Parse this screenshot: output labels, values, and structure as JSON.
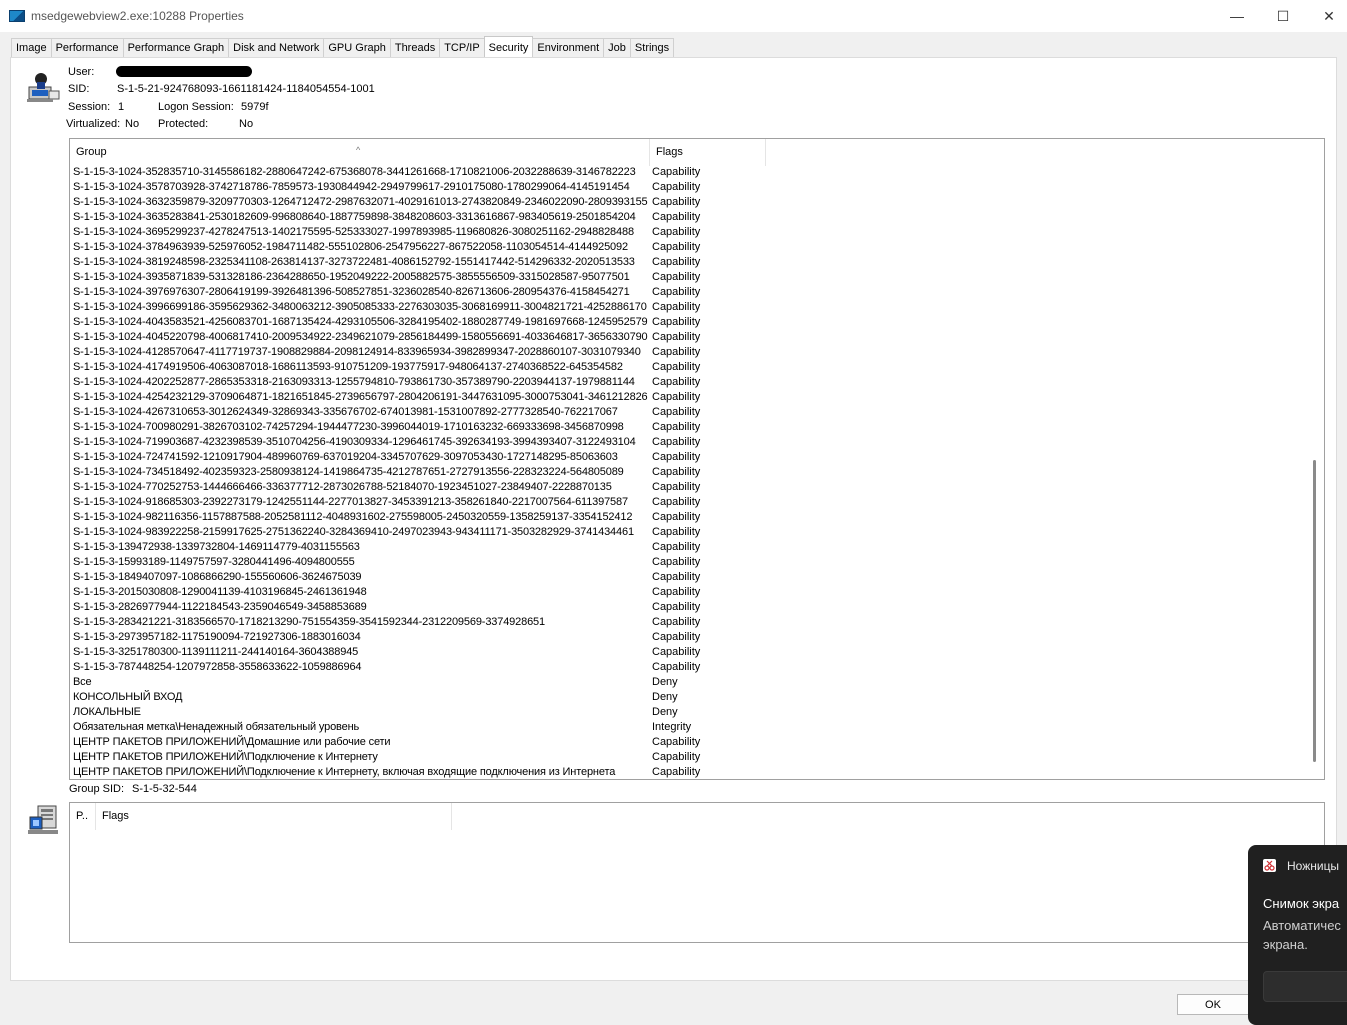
{
  "window": {
    "title": "msedgewebview2.exe:10288 Properties",
    "minimize": "—",
    "maximize": "☐",
    "close": "✕"
  },
  "tabs": [
    "Image",
    "Performance",
    "Performance Graph",
    "Disk and Network",
    "GPU Graph",
    "Threads",
    "TCP/IP",
    "Security",
    "Environment",
    "Job",
    "Strings"
  ],
  "active_tab": "Security",
  "info": {
    "user_label": "User:",
    "user_value": "",
    "sid_label": "SID:",
    "sid_value": "S-1-5-21-924768093-1661181424-1184054554-1001",
    "session_label": "Session:",
    "session_value": "1",
    "logon_label": "Logon Session:",
    "logon_value": "5979f",
    "virtualized_label": "Virtualized:",
    "virtualized_value": "No",
    "protected_label": "Protected:",
    "protected_value": "No"
  },
  "groups_table": {
    "col_group": "Group",
    "col_flags": "Flags",
    "rows": [
      [
        "S-1-15-3-1024-352835710-3145586182-2880647242-675368078-3441261668-1710821006-2032288639-3146782223",
        "Capability"
      ],
      [
        "S-1-15-3-1024-3578703928-3742718786-7859573-1930844942-2949799617-2910175080-1780299064-4145191454",
        "Capability"
      ],
      [
        "S-1-15-3-1024-3632359879-3209770303-1264712472-2987632071-4029161013-2743820849-2346022090-2809393155",
        "Capability"
      ],
      [
        "S-1-15-3-1024-3635283841-2530182609-996808640-1887759898-3848208603-3313616867-983405619-2501854204",
        "Capability"
      ],
      [
        "S-1-15-3-1024-3695299237-4278247513-1402175595-525333027-1997893985-119680826-3080251162-2948828488",
        "Capability"
      ],
      [
        "S-1-15-3-1024-3784963939-525976052-1984711482-555102806-2547956227-867522058-1103054514-4144925092",
        "Capability"
      ],
      [
        "S-1-15-3-1024-3819248598-2325341108-263814137-3273722481-4086152792-1551417442-514296332-2020513533",
        "Capability"
      ],
      [
        "S-1-15-3-1024-3935871839-531328186-2364288650-1952049222-2005882575-3855556509-3315028587-95077501",
        "Capability"
      ],
      [
        "S-1-15-3-1024-3976976307-2806419199-3926481396-508527851-3236028540-826713606-280954376-4158454271",
        "Capability"
      ],
      [
        "S-1-15-3-1024-3996699186-3595629362-3480063212-3905085333-2276303035-3068169911-3004821721-4252886170",
        "Capability"
      ],
      [
        "S-1-15-3-1024-4043583521-4256083701-1687135424-4293105506-3284195402-1880287749-1981697668-1245952579",
        "Capability"
      ],
      [
        "S-1-15-3-1024-4045220798-4006817410-2009534922-2349621079-2856184499-1580556691-4033646817-3656330790",
        "Capability"
      ],
      [
        "S-1-15-3-1024-4128570647-4117719737-1908829884-2098124914-833965934-3982899347-2028860107-3031079340",
        "Capability"
      ],
      [
        "S-1-15-3-1024-4174919506-4063087018-1686113593-910751209-193775917-948064137-2740368522-645354582",
        "Capability"
      ],
      [
        "S-1-15-3-1024-4202252877-2865353318-2163093313-1255794810-793861730-357389790-2203944137-1979881144",
        "Capability"
      ],
      [
        "S-1-15-3-1024-4254232129-3709064871-1821651845-2739656797-2804206191-3447631095-3000753041-3461212826",
        "Capability"
      ],
      [
        "S-1-15-3-1024-4267310653-3012624349-32869343-335676702-674013981-1531007892-2777328540-762217067",
        "Capability"
      ],
      [
        "S-1-15-3-1024-700980291-3826703102-74257294-1944477230-3996044019-1710163232-669333698-3456870998",
        "Capability"
      ],
      [
        "S-1-15-3-1024-719903687-4232398539-3510704256-4190309334-1296461745-392634193-3994393407-3122493104",
        "Capability"
      ],
      [
        "S-1-15-3-1024-724741592-1210917904-489960769-637019204-3345707629-3097053430-1727148295-85063603",
        "Capability"
      ],
      [
        "S-1-15-3-1024-734518492-402359323-2580938124-1419864735-4212787651-2727913556-228323224-564805089",
        "Capability"
      ],
      [
        "S-1-15-3-1024-770252753-1444666466-336377712-2873026788-52184070-1923451027-23849407-2228870135",
        "Capability"
      ],
      [
        "S-1-15-3-1024-918685303-2392273179-1242551144-2277013827-3453391213-358261840-2217007564-611397587",
        "Capability"
      ],
      [
        "S-1-15-3-1024-982116356-1157887588-2052581112-4048931602-275598005-2450320559-1358259137-3354152412",
        "Capability"
      ],
      [
        "S-1-15-3-1024-983922258-2159917625-2751362240-3284369410-2497023943-943411171-3503282929-3741434461",
        "Capability"
      ],
      [
        "S-1-15-3-139472938-1339732804-1469114779-4031155563",
        "Capability"
      ],
      [
        "S-1-15-3-15993189-1149757597-3280441496-4094800555",
        "Capability"
      ],
      [
        "S-1-15-3-1849407097-1086866290-155560606-3624675039",
        "Capability"
      ],
      [
        "S-1-15-3-2015030808-1290041139-4103196845-2461361948",
        "Capability"
      ],
      [
        "S-1-15-3-2826977944-1122184543-2359046549-3458853689",
        "Capability"
      ],
      [
        "S-1-15-3-283421221-3183566570-1718213290-751554359-3541592344-2312209569-3374928651",
        "Capability"
      ],
      [
        "S-1-15-3-2973957182-1175190094-721927306-1883016034",
        "Capability"
      ],
      [
        "S-1-15-3-3251780300-1139111211-244140164-3604388945",
        "Capability"
      ],
      [
        "S-1-15-3-787448254-1207972858-3558633622-1059886964",
        "Capability"
      ],
      [
        "Все",
        "Deny"
      ],
      [
        "КОНСОЛЬНЫЙ ВХОД",
        "Deny"
      ],
      [
        "ЛОКАЛЬНЫЕ",
        "Deny"
      ],
      [
        "Обязательная метка\\Ненадежный обязательный уровень",
        "Integrity"
      ],
      [
        "ЦЕНТР ПАКЕТОВ ПРИЛОЖЕНИЙ\\Домашние или рабочие сети",
        "Capability"
      ],
      [
        "ЦЕНТР ПАКЕТОВ ПРИЛОЖЕНИЙ\\Подключение к Интернету",
        "Capability"
      ],
      [
        "ЦЕНТР ПАКЕТОВ ПРИЛОЖЕНИЙ\\Подключение к Интернету, включая входящие подключения из Интернета",
        "Capability"
      ]
    ]
  },
  "group_sid": {
    "label": "Group SID:",
    "value": "S-1-5-32-544"
  },
  "privileges_table": {
    "col_privilege": "P..",
    "col_flags": "Flags"
  },
  "ok_button": "OK",
  "toast": {
    "app_name": "Ножницы",
    "title": "Снимок экра",
    "body_line1": "Автоматичес",
    "body_line2": "экрана."
  }
}
